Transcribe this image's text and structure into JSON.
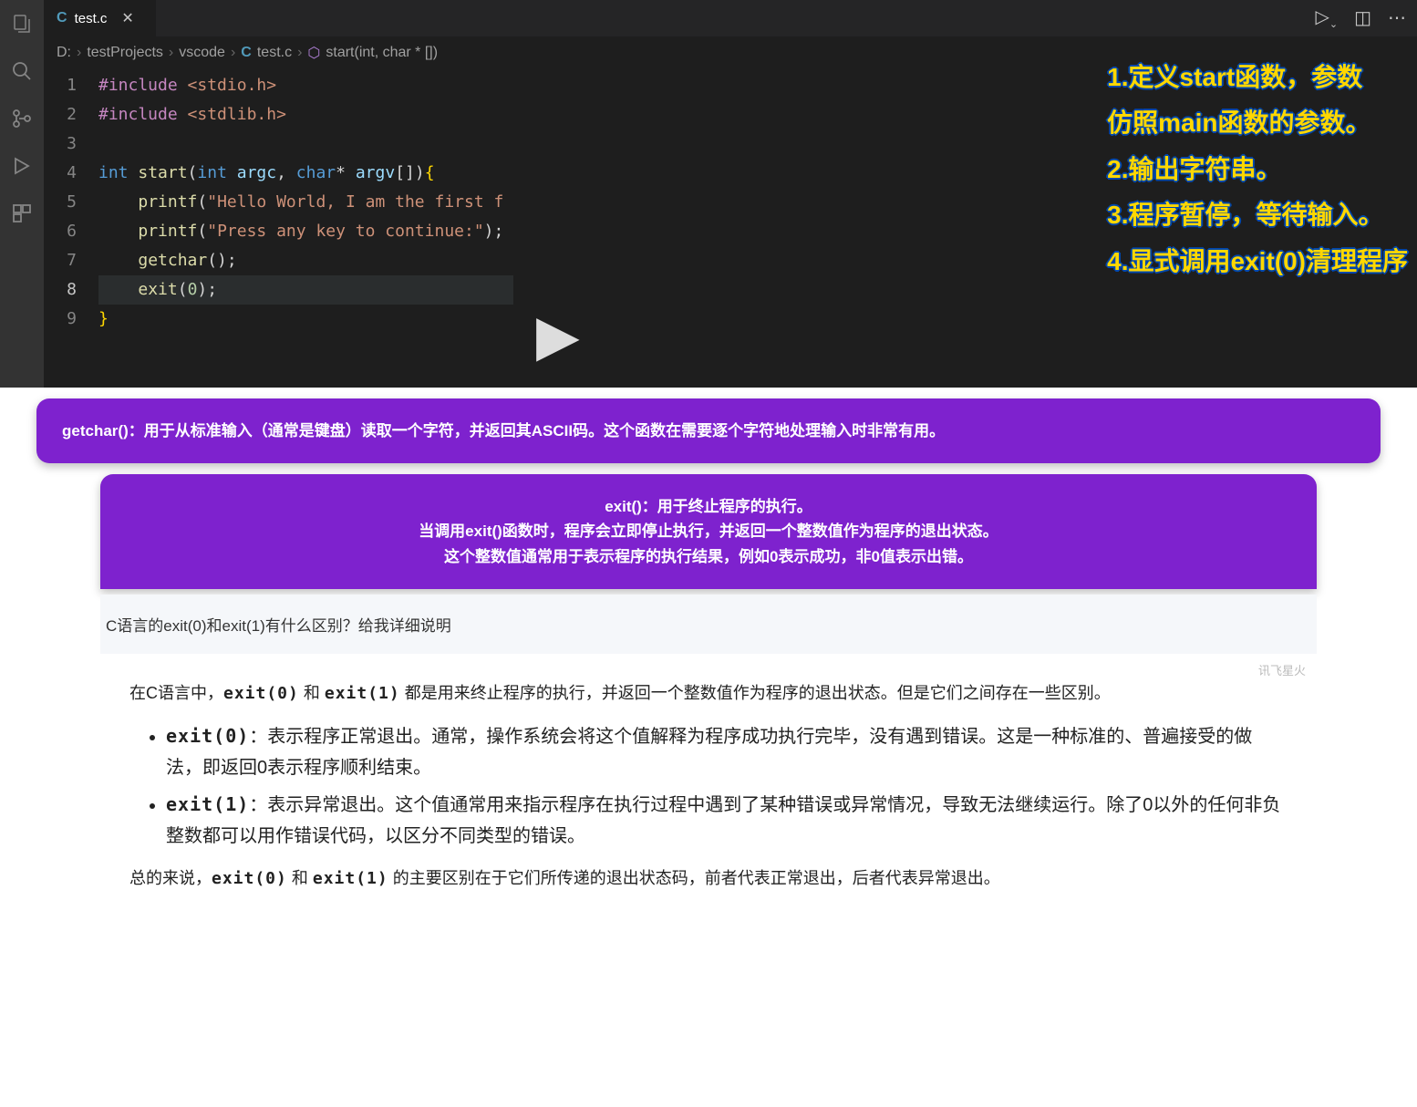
{
  "tab": {
    "lang": "C",
    "name": "test.c"
  },
  "breadcrumb": {
    "drive": "D:",
    "path1": "testProjects",
    "path2": "vscode",
    "file": "test.c",
    "symbol": "start(int, char * [])"
  },
  "gutter": [
    "1",
    "2",
    "3",
    "4",
    "5",
    "6",
    "7",
    "8",
    "9"
  ],
  "code": {
    "l1a": "#include ",
    "l1b": "<stdio.h>",
    "l2a": "#include ",
    "l2b": "<stdlib.h>",
    "l4_int": "int",
    "l4_start": " start",
    "l4_p1": "(",
    "l4_int2": "int",
    "l4_argc": " argc",
    "l4_comma": ", ",
    "l4_char": "char",
    "l4_star": "* ",
    "l4_argv": "argv",
    "l4_brk": "[])",
    "l4_brace": "{",
    "l5_fn": "printf",
    "l5_p": "(",
    "l5_str": "\"Hello World, I am the first f ",
    "l5_c": "",
    "l6_fn": "printf",
    "l6_p": "(",
    "l6_str": "\"Press any key to continue:\"",
    "l6_end": ");",
    "l7_fn": "getchar",
    "l7_end": "();",
    "l8_fn": "exit",
    "l8_p": "(",
    "l8_n": "0",
    "l8_end": ");",
    "l9": "}"
  },
  "annotations": {
    "a1": "1.定义start函数，参数",
    "a1b": "仿照main函数的参数。",
    "a2": "2.输出字符串。",
    "a3": "3.程序暂停，等待输入。",
    "a4": "4.显式调用exit(0)清理程序"
  },
  "box1": "getchar()：用于从标准输入（通常是键盘）读取一个字符，并返回其ASCII码。这个函数在需要逐个字符地处理输入时非常有用。",
  "box2": {
    "l1": "exit()：用于终止程序的执行。",
    "l2": "当调用exit()函数时，程序会立即停止执行，并返回一个整数值作为程序的退出状态。",
    "l3": "这个整数值通常用于表示程序的执行结果，例如0表示成功，非0值表示出错。"
  },
  "chat": {
    "question": "C语言的exit(0)和exit(1)有什么区别？给我详细说明",
    "watermark": "讯飞星火",
    "intro": "在C语言中，",
    "e0": "exit(0)",
    "and": " 和 ",
    "e1": "exit(1)",
    "intro2": " 都是用来终止程序的执行，并返回一个整数值作为程序的退出状态。但是它们之间存在一些区别。",
    "li1_code": "exit(0)",
    "li1_text": "：表示程序正常退出。通常，操作系统会将这个值解释为程序成功执行完毕，没有遇到错误。这是一种标准的、普遍接受的做法，即返回0表示程序顺利结束。",
    "li2_code": "exit(1)",
    "li2_text": "：表示异常退出。这个值通常用来指示程序在执行过程中遇到了某种错误或异常情况，导致无法继续运行。除了0以外的任何非负整数都可以用作错误代码，以区分不同类型的错误。",
    "summary1": "总的来说，",
    "summary2": " 的主要区别在于它们所传递的退出状态码，前者代表正常退出，后者代表异常退出。"
  }
}
